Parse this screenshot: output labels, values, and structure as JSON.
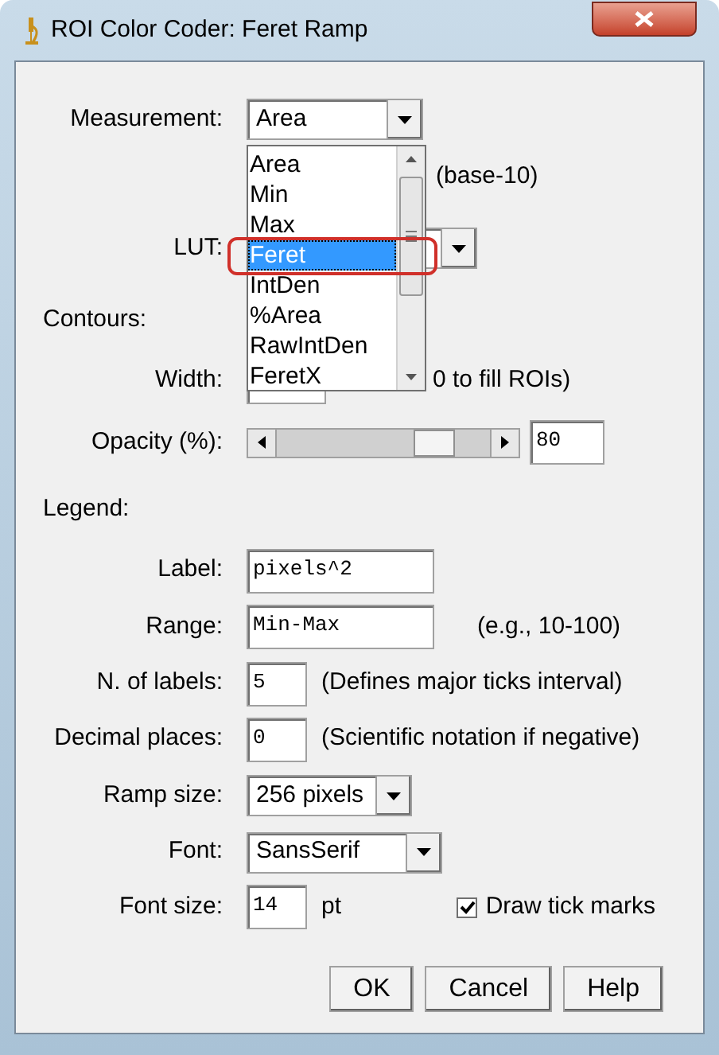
{
  "window": {
    "title": "ROI Color Coder: Feret Ramp"
  },
  "measurement": {
    "label": "Measurement:",
    "value": "Area",
    "list": [
      {
        "label": "Area",
        "highlighted": false
      },
      {
        "label": "Min",
        "highlighted": false
      },
      {
        "label": "Max",
        "highlighted": false
      },
      {
        "label": "Feret",
        "highlighted": true
      },
      {
        "label": "IntDen",
        "highlighted": false
      },
      {
        "label": "%Area",
        "highlighted": false
      },
      {
        "label": "RawIntDen",
        "highlighted": false
      },
      {
        "label": "FeretX",
        "highlighted": false
      }
    ]
  },
  "log_note": "(base-10)",
  "lut": {
    "label": "LUT:"
  },
  "contours": {
    "heading": "Contours:",
    "width": {
      "label": "Width:",
      "note": "0 to fill ROIs)"
    },
    "opacity": {
      "label": "Opacity (%):",
      "level": 0.8,
      "value": "80"
    }
  },
  "legend": {
    "heading": "Legend:",
    "rows": [
      {
        "kind": "text",
        "label": "Label:",
        "value": "pixels^2"
      },
      {
        "kind": "text",
        "label": "Range:",
        "value": "Min-Max",
        "note": "(e.g., 10-100)"
      },
      {
        "kind": "number",
        "label": "N. of labels:",
        "value": "5",
        "note": "(Defines major ticks interval)"
      },
      {
        "kind": "number",
        "label": "Decimal places:",
        "value": "0",
        "note": "(Scientific notation if negative)"
      },
      {
        "kind": "select",
        "label": "Ramp size:",
        "value": "256 pixels"
      },
      {
        "kind": "select",
        "label": "Font:",
        "value": "SansSerif"
      },
      {
        "kind": "number",
        "label": "Font size:",
        "value": "14",
        "note": "pt",
        "checkbox": {
          "label": "Draw tick marks",
          "checked": true
        }
      }
    ]
  },
  "buttons": [
    "OK",
    "Cancel",
    "Help"
  ]
}
